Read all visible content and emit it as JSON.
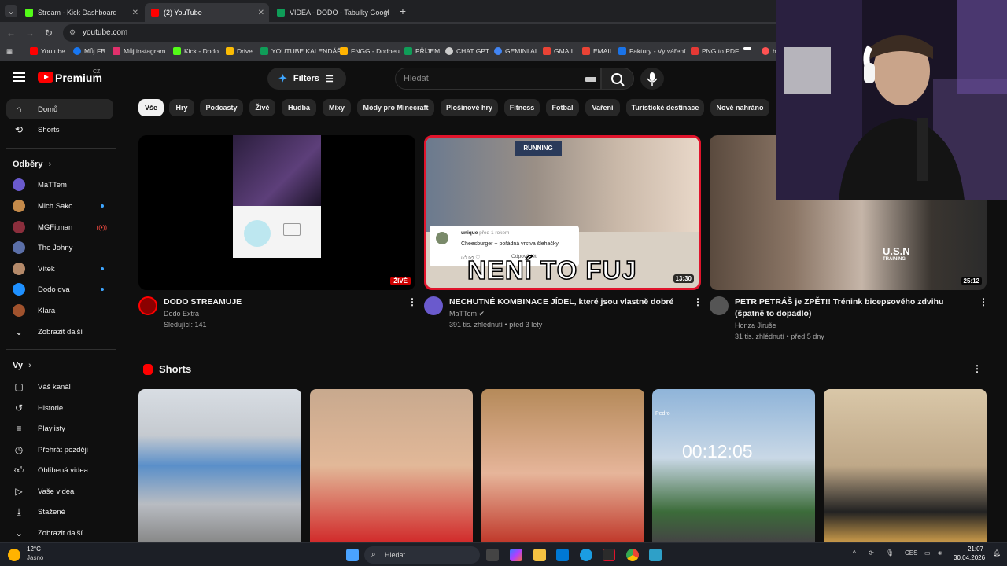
{
  "browser": {
    "tabs": [
      {
        "label": "Stream - Kick Dashboard",
        "active": false,
        "favicon_color": "#53fc18"
      },
      {
        "label": "(2) YouTube",
        "active": true,
        "favicon_color": "#ff0000"
      },
      {
        "label": "VIDEA - DODO - Tabulky Googl",
        "active": false,
        "favicon_color": "#0f9d58"
      }
    ],
    "new_tab": "+",
    "url": "youtube.com",
    "bookmarks": [
      {
        "label": "Youtube",
        "color": "#ff0000"
      },
      {
        "label": "Můj FB",
        "color": "#1877f2"
      },
      {
        "label": "Můj instagram",
        "color": "#e1306c"
      },
      {
        "label": "Kick - Dodo",
        "color": "#53fc18"
      },
      {
        "label": "Drive",
        "color": "#fbbc04"
      },
      {
        "label": "YOUTUBE KALENDÁŘ",
        "color": "#0f9d58"
      },
      {
        "label": "FNGG - Dodoeu",
        "color": "#ffb300"
      },
      {
        "label": "PŘÍJEM",
        "color": "#0f9d58"
      },
      {
        "label": "CHAT GPT",
        "color": "#cccccc"
      },
      {
        "label": "GEMINI AI",
        "color": "#4285f4"
      },
      {
        "label": "GMAIL",
        "color": "#ea4335"
      },
      {
        "label": "EMAIL",
        "color": "#ea4335"
      },
      {
        "label": "Faktury - Vytváření",
        "color": "#1a73e8"
      },
      {
        "label": "PNG to PDF",
        "color": "#e53935"
      },
      {
        "label": "",
        "color": "#ffffff"
      },
      {
        "label": "h",
        "color": "#ff5252"
      }
    ]
  },
  "youtube": {
    "brand": "Premium",
    "region": "CZ",
    "filters_label": "Filters",
    "search_placeholder": "Hledat",
    "chips": [
      "Vše",
      "Hry",
      "Podcasty",
      "Živě",
      "Hudba",
      "Mixy",
      "Módy pro Minecraft",
      "Plošinové hry",
      "Fitness",
      "Fotbal",
      "Vaření",
      "Turistické destinace",
      "Nově nahráno"
    ]
  },
  "sidebar": {
    "top": [
      {
        "label": "Domů",
        "icon": "home-icon",
        "active": true
      },
      {
        "label": "Shorts",
        "icon": "shorts-icon",
        "active": false
      }
    ],
    "subscriptions_heading": "Odběry",
    "subscriptions": [
      {
        "label": "MaTTem",
        "color": "#6a5acd",
        "indicator": ""
      },
      {
        "label": "Mich Sako",
        "color": "#c48a4a",
        "indicator": "dot"
      },
      {
        "label": "MGFitman",
        "color": "#8b2e3c",
        "indicator": "live"
      },
      {
        "label": "The Johny",
        "color": "#5b6fa8",
        "indicator": ""
      },
      {
        "label": "Vítek",
        "color": "#b58a6a",
        "indicator": "dot"
      },
      {
        "label": "Dodo dva",
        "color": "#1e90ff",
        "indicator": "dot"
      },
      {
        "label": "Klara",
        "color": "#a0522d",
        "indicator": ""
      }
    ],
    "show_more_1": "Zobrazit další",
    "you_heading": "Vy",
    "you_items": [
      {
        "label": "Váš kanál",
        "icon": "channel-icon"
      },
      {
        "label": "Historie",
        "icon": "history-icon"
      },
      {
        "label": "Playlisty",
        "icon": "playlist-icon"
      },
      {
        "label": "Přehrát později",
        "icon": "watch-later-icon"
      },
      {
        "label": "Oblíbená videa",
        "icon": "like-icon"
      },
      {
        "label": "Vaše videa",
        "icon": "video-icon"
      },
      {
        "label": "Stažené",
        "icon": "download-icon"
      }
    ],
    "show_more_2": "Zobrazit další"
  },
  "videos": [
    {
      "title": "DODO STREAMUJE",
      "channel": "Dodo Extra",
      "meta": "Sledující: 141",
      "badge": "ŽIVĚ",
      "avatar_label": "ŽIVĚ"
    },
    {
      "title": "NECHUTNÉ KOMBINACE JÍDEL, které jsou vlastně dobré",
      "channel": "MaTTem",
      "meta": "391 tis. zhlédnutí • před 3 lety",
      "duration": "13:30",
      "thumb_text": "NENÍ TO FUJ",
      "thumb_banner": "RUNNING",
      "comment_user": "unique",
      "comment_time": "před 1 rokem",
      "comment_text": "Cheesburger + pořádná vrstva šlehačky",
      "comment_reply": "Odpovědět"
    },
    {
      "title": "PETR PETRÁŠ je ZPĚT!! Trénink bicepsového zdvihu (špatně to dopadlo)",
      "channel": "Honza Jiruše",
      "meta": "31 tis. zhlédnutí • před 5 dny",
      "duration": "25:12",
      "thumb_shirt": "U.S.N",
      "thumb_shirt_sub": "TRAINING"
    }
  ],
  "shorts": {
    "heading": "Shorts",
    "items": [
      {
        "colors": [
          "#d8dde3",
          "#5a8fc9",
          "#b8bcc2"
        ]
      },
      {
        "colors": [
          "#c8a98e",
          "#e2b898",
          "#d12b2b"
        ]
      },
      {
        "colors": [
          "#b58a5a",
          "#e6b59a",
          "#c0392b"
        ]
      },
      {
        "colors": [
          "#8fb4d9",
          "#3c6c3a",
          "#444"
        ],
        "timer": "00:12:05",
        "corner_text": "Pedro"
      },
      {
        "colors": [
          "#d9c7a8",
          "#222",
          "#c99a4a"
        ]
      }
    ]
  },
  "taskbar": {
    "weather_temp": "12°C",
    "weather_desc": "Jasno",
    "search_placeholder": "Hledat",
    "language": "CES",
    "time": "21:07",
    "date": "30.04.2026"
  }
}
